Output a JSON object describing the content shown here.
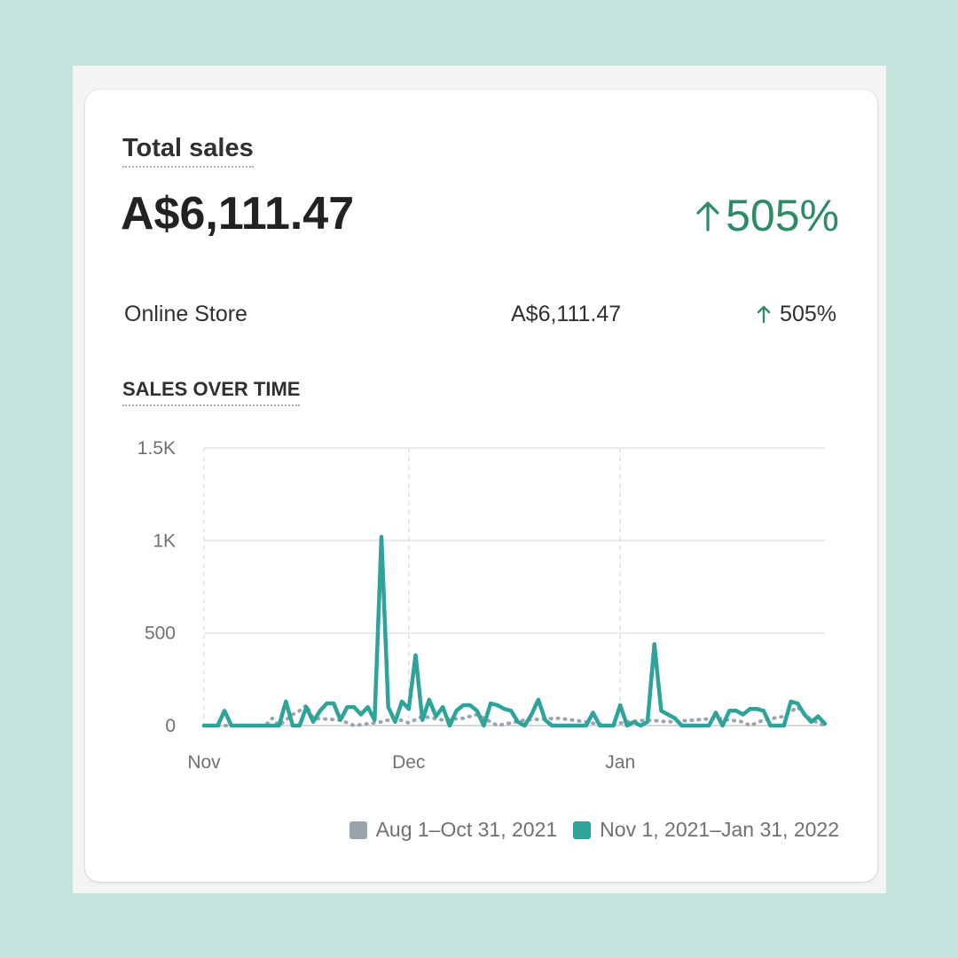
{
  "card": {
    "title": "Total sales",
    "total_value": "A$6,111.47",
    "total_change": "505%",
    "breakdown": [
      {
        "channel": "Online Store",
        "amount": "A$6,111.47",
        "change": "505%"
      }
    ],
    "section_title": "SALES OVER TIME"
  },
  "colors": {
    "positive": "#2e8b63",
    "current_series": "#2ea39a",
    "previous_series": "#9aa4ad"
  },
  "chart_data": {
    "type": "line",
    "title": "",
    "xlabel": "",
    "ylabel": "",
    "ylim": [
      0,
      1500
    ],
    "yticks": [
      0,
      500,
      1000,
      1500
    ],
    "ytick_labels": [
      "0",
      "500",
      "1K",
      "1.5K"
    ],
    "xtick_labels": [
      {
        "label": "Nov",
        "day": 0
      },
      {
        "label": "Dec",
        "day": 30
      },
      {
        "label": "Jan",
        "day": 61
      }
    ],
    "x_day_range": [
      0,
      91
    ],
    "grid": true,
    "legend_position": "bottom-right",
    "series": [
      {
        "name": "Aug 1–Oct 31, 2021",
        "style": "dotted",
        "x": [
          0,
          5,
          9,
          10,
          11,
          13,
          14,
          15,
          16,
          20,
          22,
          26,
          28,
          30,
          32,
          35,
          38,
          40,
          42,
          43,
          47,
          52,
          56,
          59,
          62,
          65,
          68,
          72,
          75,
          79,
          80,
          82,
          85,
          87,
          89,
          91
        ],
        "values": [
          0,
          0,
          0,
          40,
          0,
          60,
          80,
          110,
          40,
          30,
          0,
          20,
          40,
          15,
          50,
          30,
          40,
          60,
          20,
          0,
          30,
          40,
          20,
          0,
          20,
          30,
          20,
          30,
          40,
          20,
          0,
          30,
          50,
          100,
          30,
          0
        ]
      },
      {
        "name": "Nov 1, 2021–Jan 31, 2022",
        "style": "solid",
        "x": [
          0,
          1,
          2,
          3,
          4,
          5,
          6,
          7,
          8,
          9,
          10,
          11,
          12,
          13,
          14,
          15,
          16,
          17,
          18,
          19,
          20,
          21,
          22,
          23,
          24,
          25,
          26,
          27,
          28,
          29,
          30,
          31,
          32,
          33,
          34,
          35,
          36,
          37,
          38,
          39,
          40,
          41,
          42,
          43,
          44,
          45,
          46,
          47,
          48,
          49,
          50,
          51,
          52,
          53,
          54,
          55,
          56,
          57,
          58,
          59,
          60,
          61,
          62,
          63,
          64,
          65,
          66,
          67,
          68,
          69,
          70,
          71,
          72,
          73,
          74,
          75,
          76,
          77,
          78,
          79,
          80,
          81,
          82,
          83,
          84,
          85,
          86,
          87,
          88,
          89,
          90,
          91
        ],
        "values": [
          0,
          0,
          0,
          80,
          0,
          0,
          0,
          0,
          0,
          0,
          0,
          0,
          130,
          0,
          0,
          100,
          20,
          80,
          120,
          120,
          30,
          100,
          100,
          60,
          100,
          30,
          1020,
          100,
          20,
          130,
          90,
          380,
          30,
          140,
          50,
          100,
          0,
          80,
          110,
          110,
          80,
          0,
          120,
          110,
          90,
          80,
          20,
          0,
          60,
          140,
          30,
          0,
          0,
          0,
          0,
          0,
          0,
          70,
          0,
          0,
          0,
          110,
          0,
          20,
          0,
          20,
          440,
          80,
          60,
          40,
          0,
          0,
          0,
          0,
          0,
          70,
          0,
          80,
          80,
          60,
          90,
          90,
          80,
          0,
          0,
          0,
          130,
          120,
          60,
          20,
          50,
          10
        ]
      }
    ]
  },
  "legend": {
    "previous_label": "Aug 1–Oct 31, 2021",
    "current_label": "Nov 1, 2021–Jan 31, 2022"
  }
}
